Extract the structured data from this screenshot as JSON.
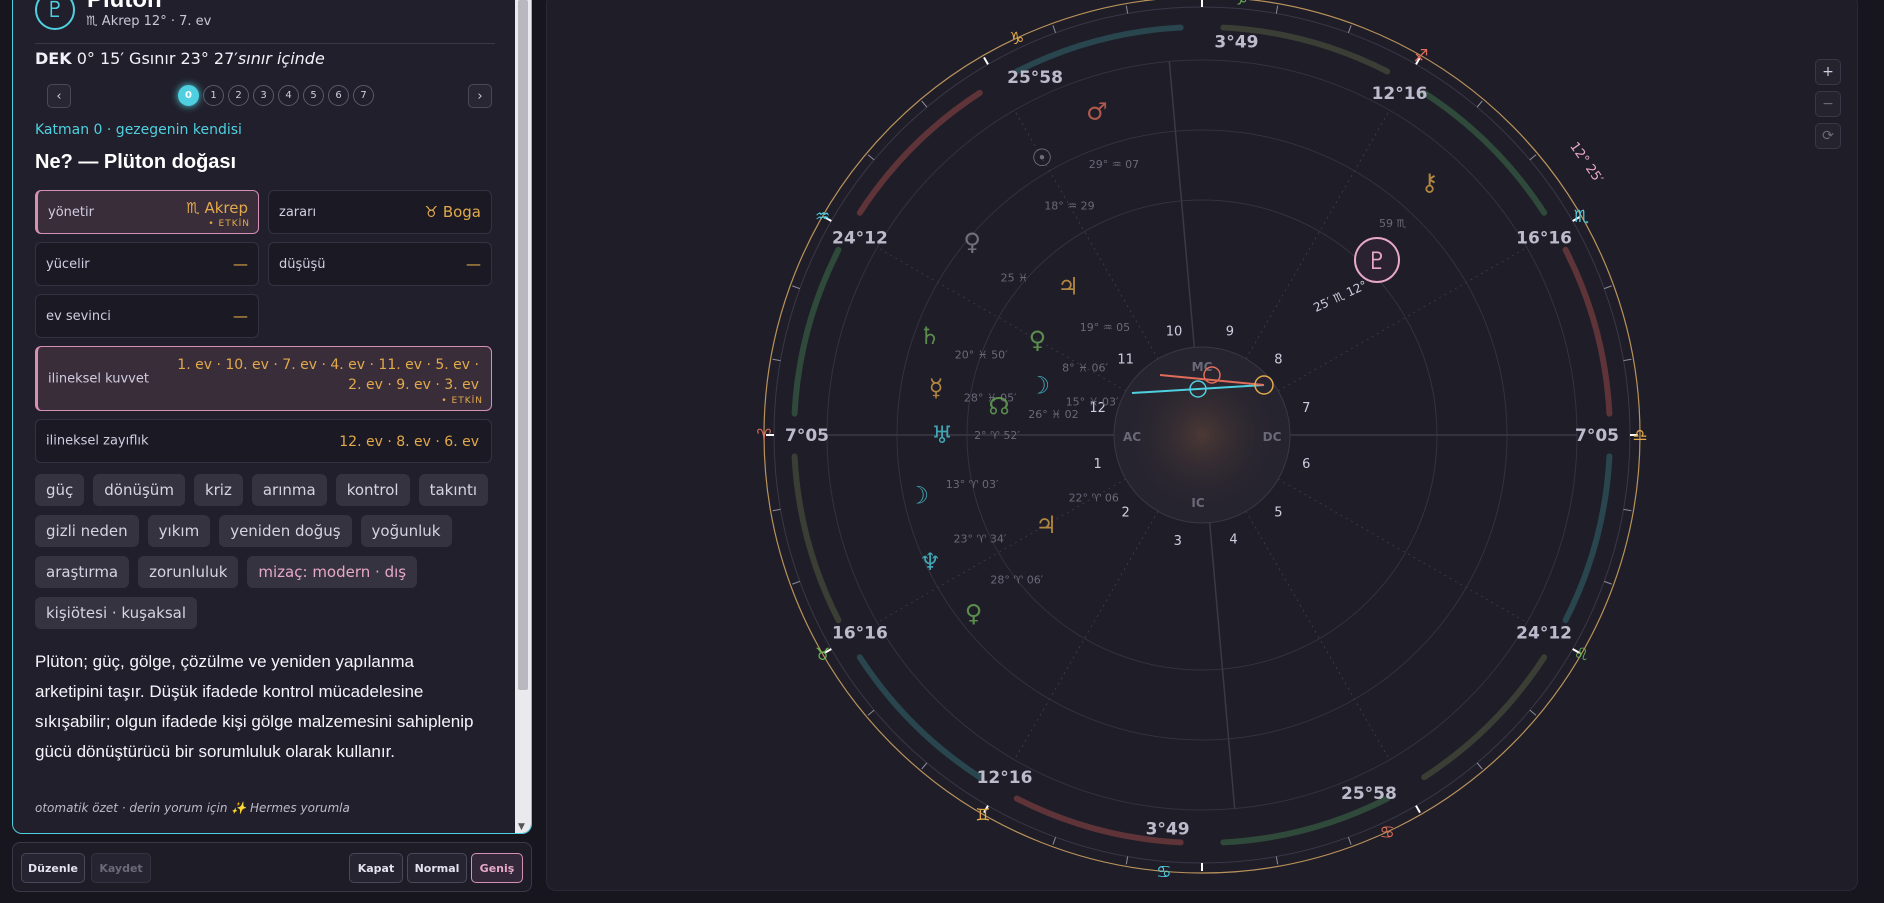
{
  "planet": {
    "glyph": "♇",
    "name": "Plüton",
    "sign_glyph": "♏",
    "position_text": "Akrep 12° · 7. ev"
  },
  "dek": {
    "label": "DEK",
    "value": "0° 15′ Gsınır 23° 27′",
    "status": "sınır içinde"
  },
  "pager": {
    "prev": "‹",
    "next": "›",
    "pages": [
      "0",
      "1",
      "2",
      "3",
      "4",
      "5",
      "6",
      "7"
    ],
    "active": "0"
  },
  "layer_label": "Katman 0 · gezegenin kendisi",
  "section_title": "Ne? — Plüton doğası",
  "dignities": {
    "rules": {
      "label": "yönetir",
      "glyph": "♏",
      "value": "Akrep",
      "badge": "• ETKİN"
    },
    "detriment": {
      "label": "zararı",
      "glyph": "♉",
      "value": "Boga"
    },
    "exalt": {
      "label": "yücelir",
      "value": "—"
    },
    "fall": {
      "label": "düşüşü",
      "value": "—"
    },
    "joy": {
      "label": "ev sevinci",
      "value": "—"
    }
  },
  "accidental_strength": {
    "label": "ilineksel kuvvet",
    "line1": "1. ev · 10. ev · 7. ev · 4. ev · 11. ev · 5. ev ·",
    "line2": "2. ev · 9. ev · 3. ev",
    "badge": "• ETKİN"
  },
  "accidental_weakness": {
    "label": "ilineksel zayıflık",
    "value": "12. ev · 8. ev · 6. ev"
  },
  "tags": [
    {
      "text": "güç"
    },
    {
      "text": "dönüşüm"
    },
    {
      "text": "kriz"
    },
    {
      "text": "arınma"
    },
    {
      "text": "kontrol"
    },
    {
      "text": "takıntı"
    },
    {
      "text": "gizli neden"
    },
    {
      "text": "yıkım"
    },
    {
      "text": "yeniden doğuş"
    },
    {
      "text": "yoğunluk"
    },
    {
      "text": "araştırma"
    },
    {
      "text": "zorunluluk"
    },
    {
      "text": "mizaç: modern · dış",
      "pink": true
    },
    {
      "text": "kişiötesi · kuşaksal"
    }
  ],
  "summary": "Plüton; güç, gölge, çözülme ve yeniden yapılanma arketipini taşır. Düşük ifadede kontrol mücadelesine sıkışabilir; olgun ifadede kişi gölge malzemesini sahiplenip gücü dönüştürücü bir sorumluluk olarak kullanır.",
  "footnote": "otomatik özet · derin yorum için ✨ Hermes yorumla",
  "toolbar": {
    "edit": "Düzenle",
    "save": "Kaydet",
    "close": "Kapat",
    "normal": "Normal",
    "wide": "Geniş"
  },
  "chart": {
    "zoom_in": "+",
    "zoom_out": "−",
    "reset": "⟳",
    "angle_labels": {
      "ac": "AC",
      "dc": "DC",
      "mc": "MC",
      "ic": "IC"
    },
    "house_numbers": [
      "1",
      "2",
      "3",
      "4",
      "5",
      "6",
      "7",
      "8",
      "9",
      "10",
      "11",
      "12"
    ],
    "cusp_degrees": [
      {
        "text": "7°05",
        "glyph": "♈"
      },
      {
        "text": "16°16",
        "glyph": "♉"
      },
      {
        "text": "12°16",
        "glyph": "♊"
      },
      {
        "text": "3°49",
        "glyph": "♋"
      },
      {
        "text": "25°58",
        "glyph": "♋"
      },
      {
        "text": "24°12",
        "glyph": "♌"
      },
      {
        "text": "7°05",
        "glyph": "♎"
      },
      {
        "text": "16°16",
        "glyph": "♏"
      },
      {
        "text": "12°16",
        "glyph": "♐"
      },
      {
        "text": "3°49",
        "glyph": "♑"
      },
      {
        "text": "25°58",
        "glyph": "♑"
      },
      {
        "text": "24°12",
        "glyph": "♒"
      }
    ],
    "outer_note": "12° 25′",
    "pluto_label": "25′ ♏ 12°",
    "planets": [
      {
        "glyph": "♂",
        "deg": "29° ♒ 07"
      },
      {
        "glyph": "☉",
        "deg": "18° ♒ 29"
      },
      {
        "glyph": "♀",
        "deg": "25 ♓"
      },
      {
        "glyph": "♄",
        "deg": "20° ♓ 50′"
      },
      {
        "glyph": "☿",
        "deg": "28° ♓ 05′"
      },
      {
        "glyph": "♅",
        "deg": "2° ♈ 52′"
      },
      {
        "glyph": "☽",
        "deg": "13° ♈ 03′"
      },
      {
        "glyph": "♆",
        "deg": "23° ♈ 34′"
      },
      {
        "glyph": "♀",
        "deg": "28° ♈ 06′"
      },
      {
        "glyph": "♃",
        "deg": "22° ♈ 06"
      },
      {
        "glyph": "☊",
        "deg": "26° ♓ 02"
      },
      {
        "glyph": "☽",
        "deg": "15° ♓ 03′"
      },
      {
        "glyph": "♀",
        "deg": "8° ♓ 06′"
      },
      {
        "glyph": "♃",
        "deg": "19° ♒ 05"
      },
      {
        "glyph": "⚷",
        "deg": "59 ♏"
      }
    ]
  }
}
